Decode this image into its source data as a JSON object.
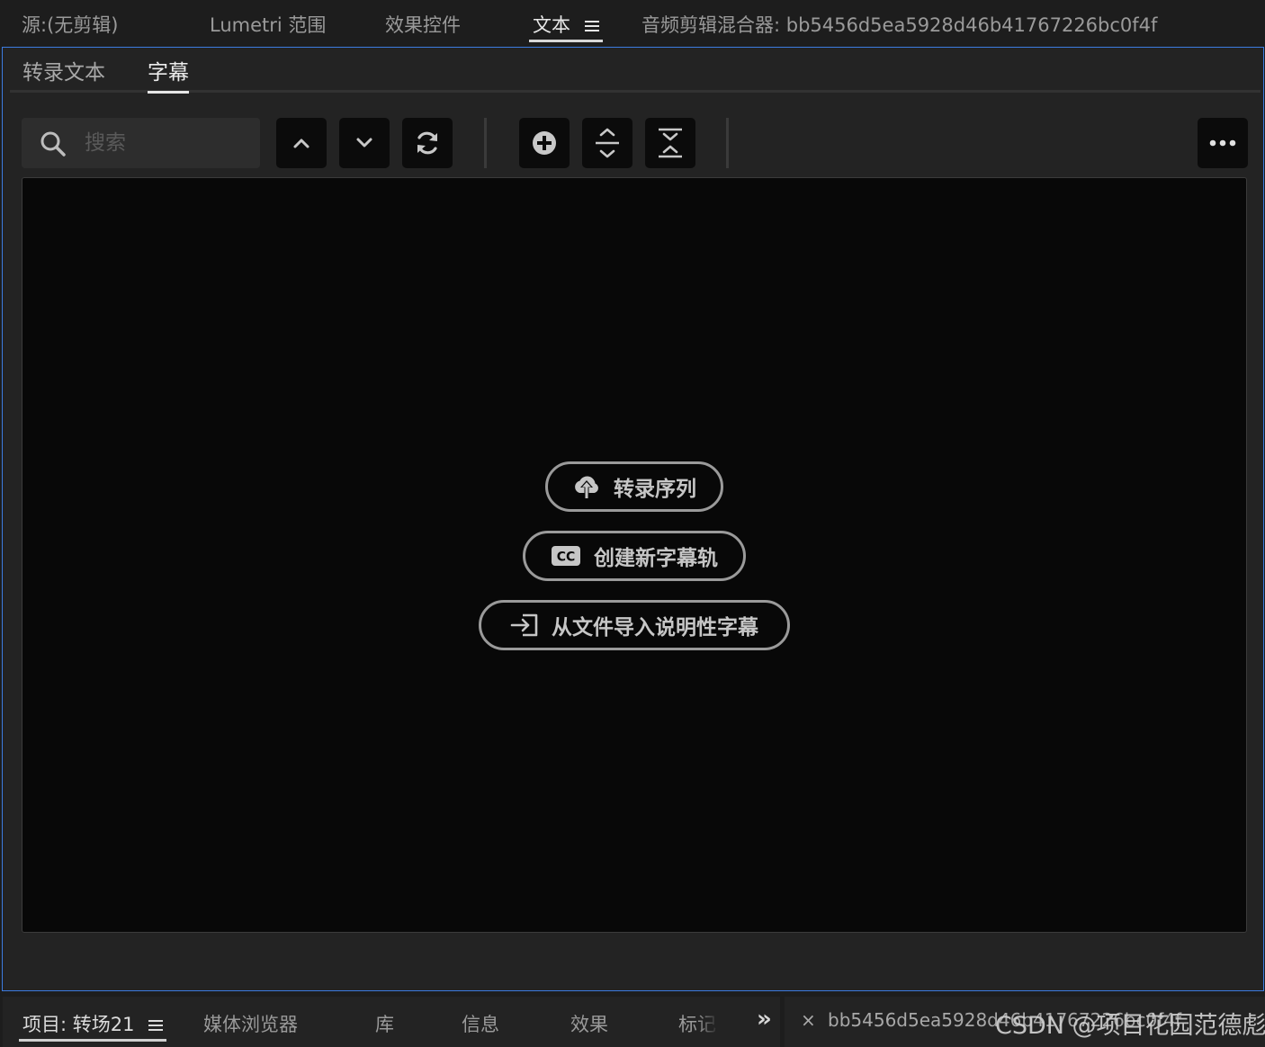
{
  "top_tabs": [
    {
      "label": "源:(无剪辑)"
    },
    {
      "label": "Lumetri 范围"
    },
    {
      "label": "效果控件"
    },
    {
      "label": "文本"
    },
    {
      "label": "音频剪辑混合器: bb5456d5ea5928d46b41767226bc0f4f"
    }
  ],
  "text_panel": {
    "sub_tabs": [
      {
        "label": "转录文本"
      },
      {
        "label": "字幕"
      }
    ],
    "search": {
      "placeholder": "搜索",
      "value": ""
    },
    "toolbar": {
      "icons": [
        "chevron-up-icon",
        "chevron-down-icon",
        "refresh-icon",
        "add-circle-icon",
        "expand-icon",
        "collapse-icon",
        "more-icon"
      ]
    },
    "actions": {
      "transcribe_label": "转录序列",
      "new_caption_label": "创建新字幕轨",
      "import_label": "从文件导入说明性字幕"
    }
  },
  "bottom_tabs": [
    {
      "label": "项目: 转场21"
    },
    {
      "label": "媒体浏览器"
    },
    {
      "label": "库"
    },
    {
      "label": "信息"
    },
    {
      "label": "效果"
    },
    {
      "label": "标记"
    }
  ],
  "bottom_overflow": "»",
  "sequence_panel": {
    "close": "×",
    "title": "bb5456d5ea5928d46b41767226bc0f4f"
  },
  "watermark": "CSDN @项目花园范德彪",
  "colors": {
    "active_border": "#3c7be0",
    "panel_bg": "#232323",
    "content_bg": "#080808"
  }
}
